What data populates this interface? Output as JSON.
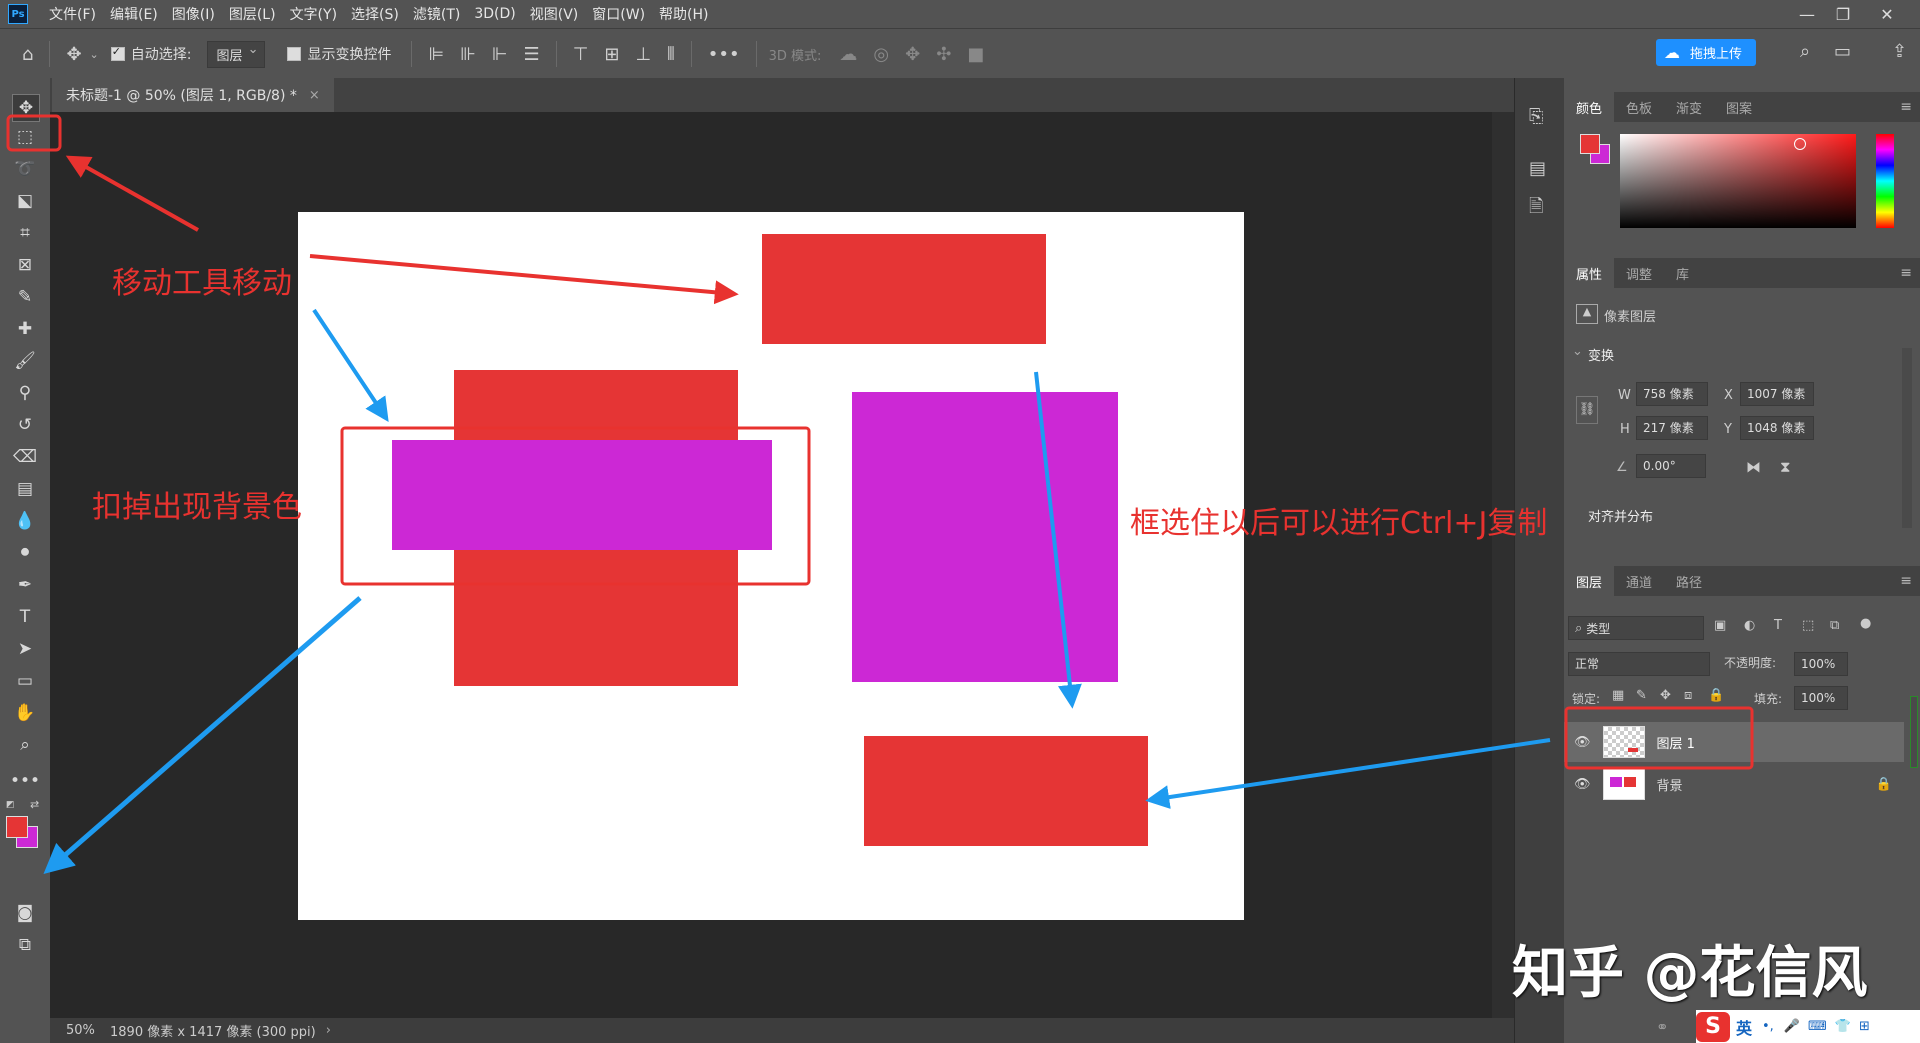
{
  "app": {
    "logo": "Ps"
  },
  "menu": [
    "文件(F)",
    "编辑(E)",
    "图像(I)",
    "图层(L)",
    "文字(Y)",
    "选择(S)",
    "滤镜(T)",
    "3D(D)",
    "视图(V)",
    "窗口(W)",
    "帮助(H)"
  ],
  "options": {
    "auto_select_label": "自动选择:",
    "auto_select_checked": true,
    "auto_select_value": "图层",
    "show_transform_label": "显示变换控件",
    "mode_3d_label": "3D 模式:",
    "upload_label": "拖拽上传"
  },
  "document": {
    "tab_title": "未标题-1 @ 50% (图层 1, RGB/8) *",
    "zoom": "50%",
    "size_info": "1890 像素 x 1417 像素 (300 ppi)"
  },
  "colors": {
    "red": "#e53535",
    "magenta": "#cc28d5",
    "foreground": "#e53535",
    "background": "#cc28d5",
    "annotation_red": "#e8322f",
    "annotation_blue": "#1e9bf0"
  },
  "color_panel": {
    "tabs": [
      "颜色",
      "色板",
      "渐变",
      "图案"
    ]
  },
  "properties_panel": {
    "tabs": [
      "属性",
      "调整",
      "库"
    ],
    "layer_type": "像素图层",
    "section_transform": "变换",
    "w_label": "W",
    "w_value": "758 像素",
    "x_label": "X",
    "x_value": "1007 像素",
    "h_label": "H",
    "h_value": "217 像素",
    "y_label": "Y",
    "y_value": "1048 像素",
    "angle_value": "0.00°",
    "section_align": "对齐并分布"
  },
  "layers_panel": {
    "tabs": [
      "图层",
      "通道",
      "路径"
    ],
    "filter_label": "类型",
    "blend_mode": "正常",
    "opacity_label": "不透明度:",
    "opacity_value": "100%",
    "lock_label": "锁定:",
    "fill_label": "填充:",
    "fill_value": "100%",
    "layers": [
      {
        "name": "图层 1",
        "selected": true
      },
      {
        "name": "背景",
        "locked": true
      }
    ]
  },
  "annotations": {
    "move_tool": "移动工具移动",
    "remove_bg": "扣掉出现背景色",
    "copy_hint": "框选住以后可以进行Ctrl+J复制"
  },
  "watermark": "知乎 @花信风",
  "ime": {
    "lang": "英"
  }
}
